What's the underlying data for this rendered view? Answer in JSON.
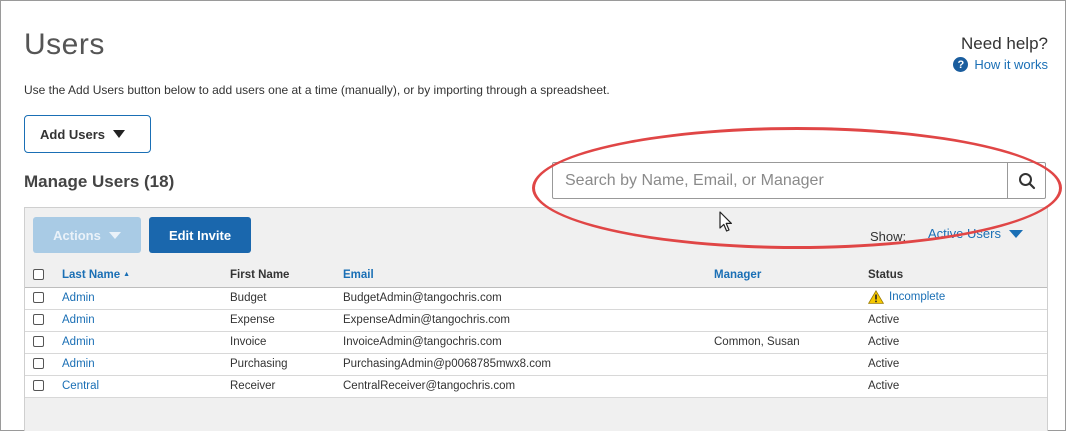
{
  "page": {
    "title": "Users",
    "description": "Use the Add Users button below to add users one at a time (manually), or by importing through a spreadsheet."
  },
  "help": {
    "title": "Need help?",
    "link_label": "How it works",
    "icon_glyph": "?"
  },
  "add_users": {
    "label": "Add Users"
  },
  "manage": {
    "title": "Manage Users (18)"
  },
  "search": {
    "placeholder": "Search by Name, Email, or Manager",
    "value": ""
  },
  "toolbar": {
    "actions_label": "Actions",
    "edit_invite_label": "Edit Invite",
    "show_label": "Show:",
    "show_value": "Active Users"
  },
  "table": {
    "columns": [
      "Last Name",
      "First Name",
      "Email",
      "Manager",
      "Status"
    ],
    "sort_indicator": "▲",
    "rows": [
      {
        "last": "Admin",
        "first": "Budget",
        "email": "BudgetAdmin@tangochris.com",
        "manager": "",
        "status": "Incomplete",
        "warning": true
      },
      {
        "last": "Admin",
        "first": "Expense",
        "email": "ExpenseAdmin@tangochris.com",
        "manager": "",
        "status": "Active",
        "warning": false
      },
      {
        "last": "Admin",
        "first": "Invoice",
        "email": "InvoiceAdmin@tangochris.com",
        "manager": "Common, Susan",
        "status": "Active",
        "warning": false
      },
      {
        "last": "Admin",
        "first": "Purchasing",
        "email": "PurchasingAdmin@p0068785mwx8.com",
        "manager": "",
        "status": "Active",
        "warning": false
      },
      {
        "last": "Central",
        "first": "Receiver",
        "email": "CentralReceiver@tangochris.com",
        "manager": "",
        "status": "Active",
        "warning": false
      }
    ]
  },
  "colors": {
    "link": "#1a6fb5",
    "primary_button": "#1a67ad",
    "disabled_button": "#a9cbe5",
    "highlight_ring": "#e04646",
    "warning": "#f5c800"
  }
}
